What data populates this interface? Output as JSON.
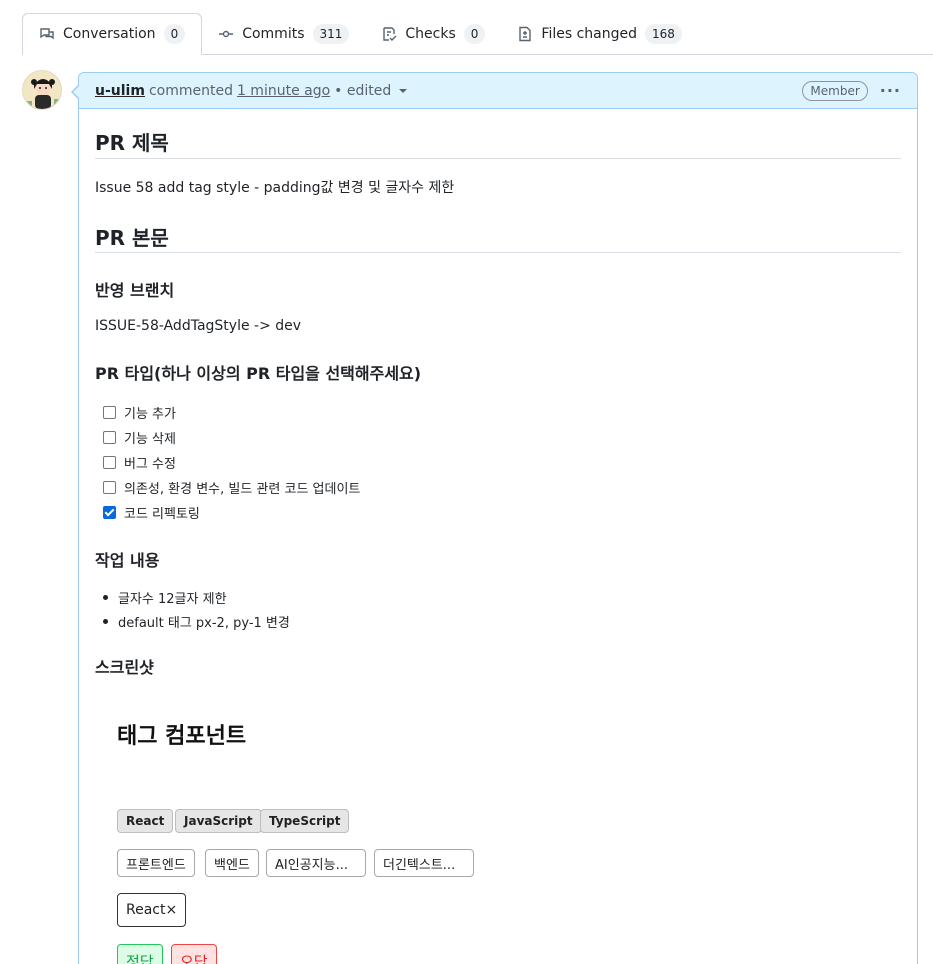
{
  "tabs": [
    {
      "label": "Conversation",
      "count": "0",
      "icon": "comment-discussion-icon",
      "active": true
    },
    {
      "label": "Commits",
      "count": "311",
      "icon": "git-commit-icon"
    },
    {
      "label": "Checks",
      "count": "0",
      "icon": "checklist-icon"
    },
    {
      "label": "Files changed",
      "count": "168",
      "icon": "file-diff-icon"
    }
  ],
  "comment": {
    "author": "u-ulim",
    "action": "commented",
    "time": "1 minute ago",
    "edited": "• edited",
    "role": "Member",
    "more": "···"
  },
  "content": {
    "h_title": "PR 제목",
    "title_text": "Issue 58 add tag style - padding값 변경 및 글자수 제한",
    "h_body": "PR 본문",
    "h_branch": "반영 브랜치",
    "branch_text": "ISSUE-58-AddTagStyle -> dev",
    "h_type": "PR 타입(하나 이상의 PR 타입을 선택해주세요)",
    "tasks": [
      {
        "label": "기능 추가",
        "checked": false
      },
      {
        "label": "기능 삭제",
        "checked": false
      },
      {
        "label": "버그 수정",
        "checked": false
      },
      {
        "label": "의존성, 환경 변수, 빌드 관련 코드 업데이트",
        "checked": false
      },
      {
        "label": "코드 리펙토링",
        "checked": true
      }
    ],
    "h_work": "작업 내용",
    "work_items": [
      "글자수 12글자 제한",
      "default 태그 px-2, py-1 변경"
    ],
    "h_screenshot": "스크린샷"
  },
  "screenshot": {
    "title": "태그 컴포넌트",
    "gray_tags": [
      "React",
      "JavaScript",
      "TypeScript"
    ],
    "outline_tags": [
      "프론트엔드",
      "백엔드",
      "AI인공지능...",
      "더긴텍스트..."
    ],
    "closable_tag": "React",
    "close_glyph": "×",
    "correct": "정답",
    "wrong": "오답"
  }
}
